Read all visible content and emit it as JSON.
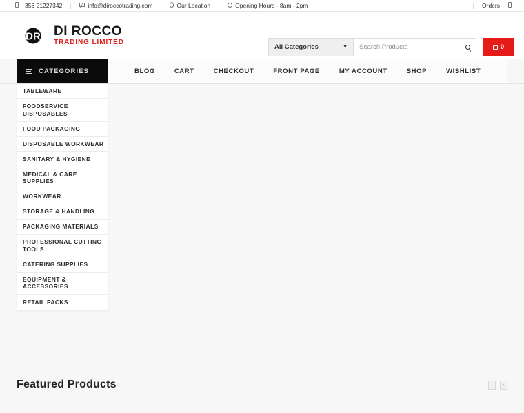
{
  "topbar": {
    "items": [
      {
        "icon": "phone-icon",
        "label": "+356 21227342"
      },
      {
        "icon": "envelope-icon",
        "label": "info@diroccotrading.com"
      },
      {
        "icon": "location-pin-icon",
        "label": "Our Location"
      },
      {
        "icon": "clock-icon",
        "label": "Opening Hours - 8am - 2pm"
      }
    ],
    "orders_label": "Orders",
    "orders_icon": "receipt-icon"
  },
  "logo": {
    "monogram": "DR",
    "title": "DI ROCCO",
    "subtitle": "TRADING LIMITED",
    "brand_red": "#e21b1b",
    "brand_dark": "#1a1a1a"
  },
  "search": {
    "category_selected": "All Categories",
    "placeholder": "Search Products",
    "value": "",
    "submit_icon": "search-icon",
    "caret_icon": "chevron-down-icon"
  },
  "cart": {
    "count": "0",
    "icon": "cart-icon",
    "color": "#e81b1b"
  },
  "nav": {
    "categories_label": "CATEGORIES",
    "categories_icon": "hamburger-icon",
    "items": [
      {
        "label": "BLOG"
      },
      {
        "label": "CART"
      },
      {
        "label": "CHECKOUT"
      },
      {
        "label": "FRONT PAGE"
      },
      {
        "label": "MY ACCOUNT"
      },
      {
        "label": "SHOP"
      },
      {
        "label": "WISHLIST"
      }
    ]
  },
  "sidebar": {
    "items": [
      {
        "label": "TABLEWARE"
      },
      {
        "label": "FOODSERVICE DISPOSABLES"
      },
      {
        "label": "FOOD PACKAGING"
      },
      {
        "label": "DISPOSABLE WORKWEAR"
      },
      {
        "label": "SANITARY & HYGIENE"
      },
      {
        "label": "MEDICAL & CARE SUPPLIES"
      },
      {
        "label": "WORKWEAR"
      },
      {
        "label": "STORAGE & HANDLING"
      },
      {
        "label": "PACKAGING MATERIALS"
      },
      {
        "label": "PROFESSIONAL CUTTING TOOLS"
      },
      {
        "label": "CATERING SUPPLIES"
      },
      {
        "label": "EQUIPMENT & ACCESSORIES"
      },
      {
        "label": "RETAIL PACKS"
      }
    ]
  },
  "featured": {
    "title": "Featured Products",
    "prev_icon": "chevron-left-icon",
    "next_icon": "chevron-right-icon",
    "prev_label": "‹",
    "next_label": "›"
  }
}
